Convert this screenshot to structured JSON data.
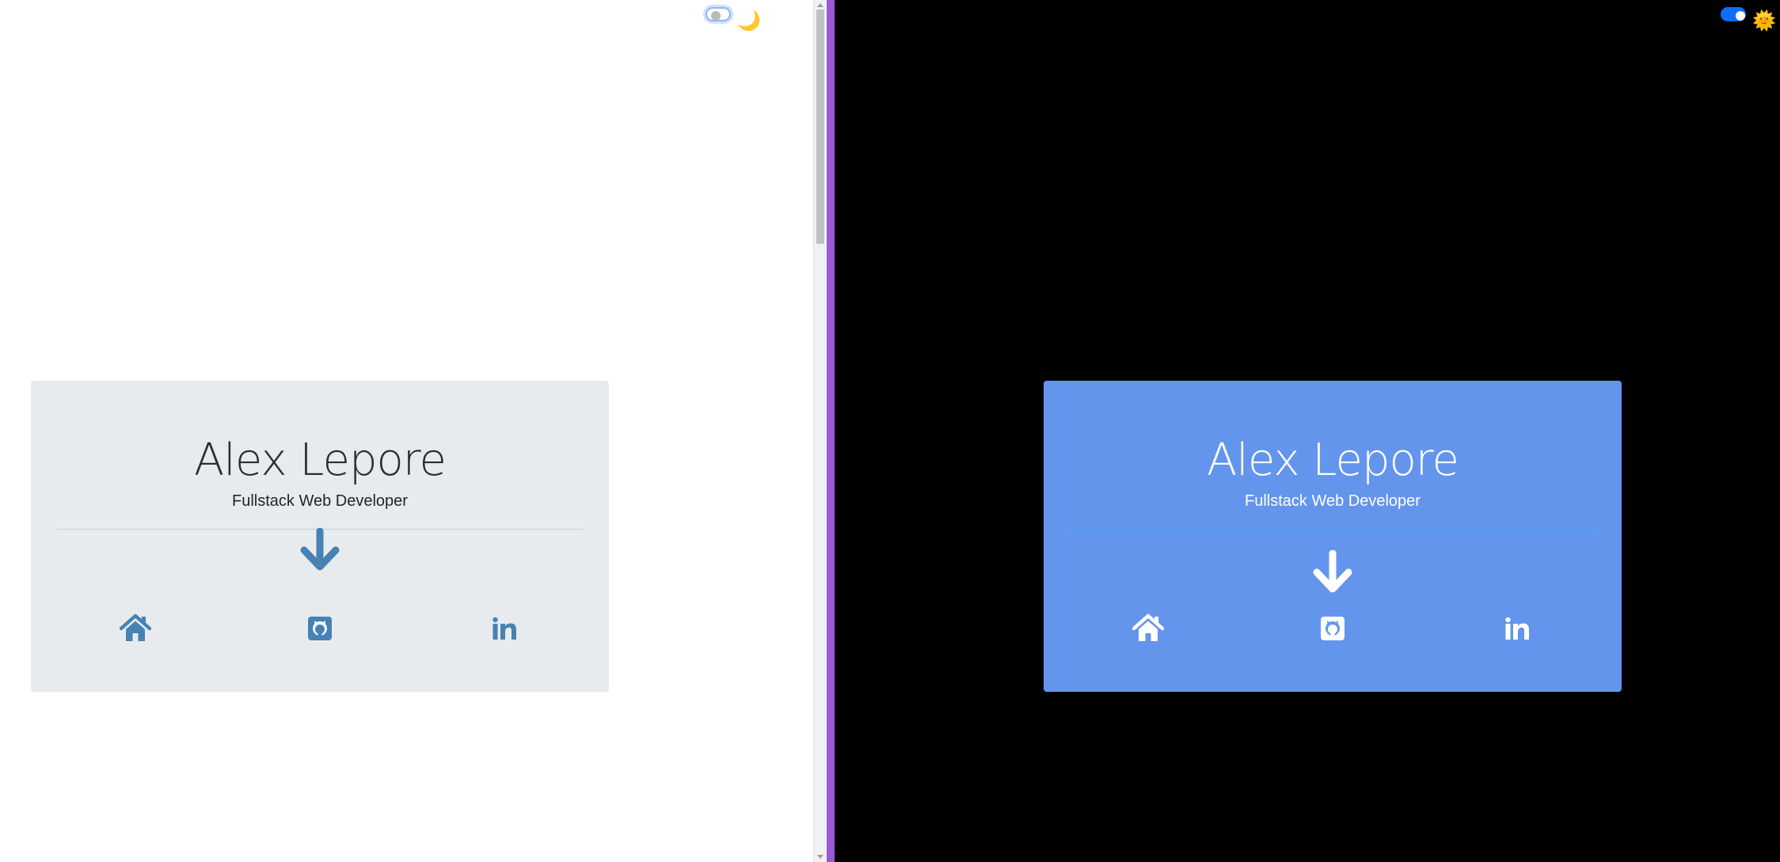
{
  "profile": {
    "name": "Alex Lepore",
    "role": "Fullstack Web Developer"
  },
  "themes": {
    "light": {
      "page_bg": "#ffffff",
      "card_bg": "#e8ebee",
      "accent": "#4682b4",
      "toggle_state": "off",
      "toggle_icon": "crescent-moon-icon",
      "toggle_glyph": "🌙"
    },
    "dark": {
      "page_bg": "#000000",
      "card_bg": "#6495ed",
      "accent": "#ffffff",
      "toggle_state": "on",
      "toggle_icon": "sun-icon",
      "toggle_glyph": "🌞"
    }
  },
  "social_links": [
    {
      "name": "home",
      "icon": "home-icon"
    },
    {
      "name": "github",
      "icon": "github-icon"
    },
    {
      "name": "linkedin",
      "icon": "linkedin-icon"
    }
  ],
  "divider_color": "#9b59d6"
}
